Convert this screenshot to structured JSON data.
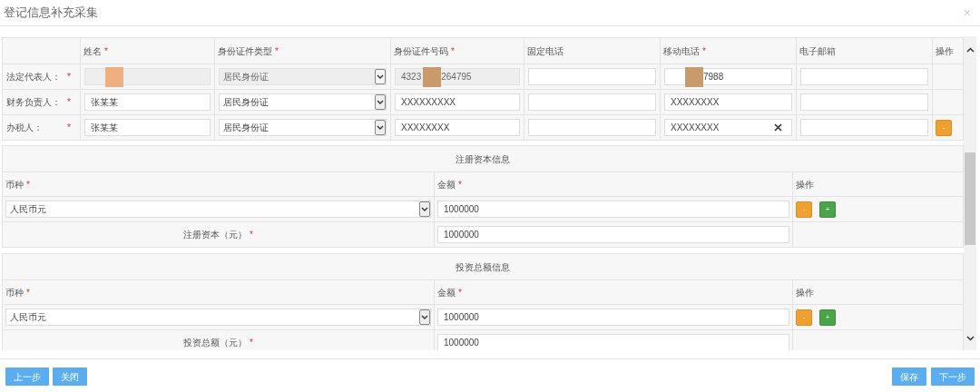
{
  "dialog": {
    "title": "登记信息补充采集",
    "close": "×"
  },
  "persons": {
    "columns": [
      {
        "text": "姓名",
        "required_mark": "*"
      },
      {
        "text": "身份证件类型",
        "required_mark": "*"
      },
      {
        "text": "身份证件号码",
        "required_mark": "*"
      },
      {
        "text": "固定电话"
      },
      {
        "text": "移动电话",
        "required_mark": "*"
      },
      {
        "text": "电子邮箱"
      },
      {
        "text": "操作"
      }
    ],
    "rows": [
      {
        "label": "法定代表人：",
        "required_mark": "*",
        "name": {
          "disabled": true,
          "redacted": true
        },
        "id_type": {
          "value": "居民身份证",
          "disabled": true
        },
        "id_number": {
          "value": "4323",
          "value_after": "264795",
          "disabled": true,
          "redacted": true
        },
        "phone": {
          "disabled": false
        },
        "mobile": {
          "value_after": "7988",
          "disabled": false,
          "redacted": true
        },
        "email": {
          "disabled": false
        },
        "actions": []
      },
      {
        "label": "财务负责人：",
        "required_mark": "*",
        "name": {
          "value": "张某某",
          "disabled": false
        },
        "id_type": {
          "value": "居民身份证",
          "disabled": false
        },
        "id_number": {
          "value": "XXXXXXXXX",
          "disabled": false
        },
        "phone": {
          "disabled": false
        },
        "mobile": {
          "value": "XXXXXXXX",
          "disabled": false
        },
        "email": {
          "disabled": false
        },
        "actions": []
      },
      {
        "label": "办税人：",
        "required_mark": "*",
        "name": {
          "value": "张某某",
          "disabled": false
        },
        "id_type": {
          "value": "居民身份证",
          "disabled": false
        },
        "id_number": {
          "value": "XXXXXXXX",
          "disabled": false
        },
        "phone": {
          "disabled": false
        },
        "mobile": {
          "value": "XXXXXXXX",
          "disabled": false,
          "focused": true,
          "clearable": true
        },
        "email": {
          "disabled": false
        },
        "actions": [
          {
            "kind": "remove",
            "label": "-"
          }
        ]
      }
    ]
  },
  "sections": [
    {
      "title": "注册资本信息",
      "columns": [
        {
          "text": "币种",
          "required_mark": "*"
        },
        {
          "text": "金额",
          "required_mark": "*"
        },
        {
          "text": "操作"
        }
      ],
      "entries": [
        {
          "currency": "人民币元",
          "amount": "1000000",
          "actions": [
            {
              "kind": "remove",
              "label": "-"
            },
            {
              "kind": "add",
              "label": "+"
            }
          ]
        }
      ],
      "total": {
        "label": "注册资本（元）",
        "required_mark": "*",
        "amount": "1000000"
      }
    },
    {
      "title": "投资总额信息",
      "columns": [
        {
          "text": "币种",
          "required_mark": "*"
        },
        {
          "text": "金额",
          "required_mark": "*"
        },
        {
          "text": "操作"
        }
      ],
      "entries": [
        {
          "currency": "人民币元",
          "amount": "1000000",
          "actions": [
            {
              "kind": "remove",
              "label": "-"
            },
            {
              "kind": "add",
              "label": "+"
            }
          ]
        }
      ],
      "total": {
        "label": "投资总额（元）",
        "required_mark": "*",
        "amount": "1000000"
      }
    }
  ],
  "footer": {
    "left_buttons": [
      "上一步",
      "关闭"
    ],
    "right_buttons": [
      "保存",
      "下一步"
    ]
  }
}
